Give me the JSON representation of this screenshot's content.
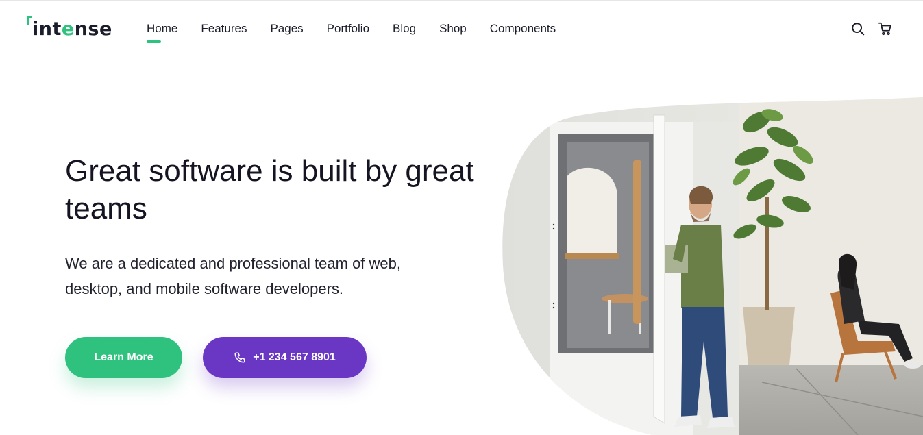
{
  "brand": {
    "logo_text_pre": "int",
    "logo_text_accent": "e",
    "logo_text_post": "nse",
    "accent_color": "#2ec27e"
  },
  "nav": {
    "items": [
      {
        "label": "Home",
        "active": true
      },
      {
        "label": "Features"
      },
      {
        "label": "Pages"
      },
      {
        "label": "Portfolio"
      },
      {
        "label": "Blog"
      },
      {
        "label": "Shop"
      },
      {
        "label": "Components"
      }
    ]
  },
  "header_icons": [
    "search-icon",
    "cart-icon"
  ],
  "hero": {
    "title": "Great software is built by great teams",
    "subtitle": "We are a dedicated and professional team of web, desktop, and mobile software developers.",
    "primary_button": "Learn More",
    "secondary_button": "+1 234 567 8901",
    "primary_color": "#2ec27e",
    "secondary_color": "#6a36c4"
  }
}
